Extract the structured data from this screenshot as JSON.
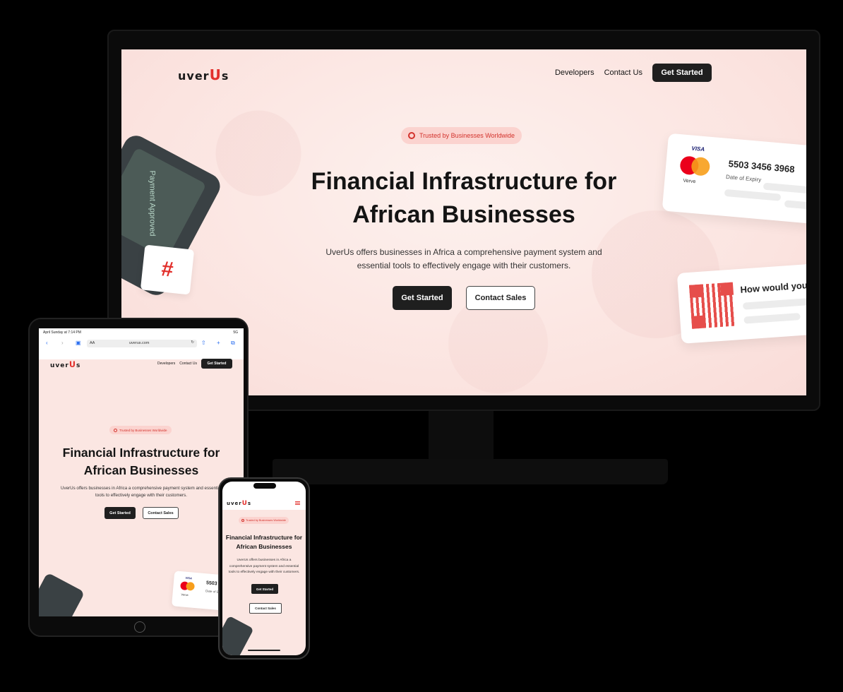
{
  "brand": {
    "logo_prefix": "uver",
    "logo_accent": "U",
    "logo_suffix": "s",
    "accent_color": "#e2302c",
    "dark_color": "#1f1f1f"
  },
  "nav": {
    "developers": "Developers",
    "contact": "Contact Us",
    "get_started": "Get Started"
  },
  "hero": {
    "badge": "Trusted by Businesses Worldwide",
    "title_line1": "Financial Infrastructure for",
    "title_line2": "African Businesses",
    "subtitle": "UverUs offers businesses in Africa a comprehensive payment system and essential tools to effectively engage with their customers.",
    "cta_primary": "Get Started",
    "cta_secondary": "Contact Sales"
  },
  "cards": {
    "pos_text": "Payment Approved",
    "hash_symbol": "#",
    "visa": "VISA",
    "verve": "Verve",
    "card_number": "5503 3456 3968",
    "card_number_short": "5503",
    "expiry_label": "Date of Expiry",
    "expiry_label_short": "Date of Expi",
    "qr_prompt": "How would you"
  },
  "tablet_browser": {
    "status_time": "April Sunday at 7:14 PM",
    "status_right": "5G",
    "aa_label": "AA",
    "url": "uverus.com"
  },
  "icons": [
    "award-icon",
    "menu-icon",
    "back-arrow-icon",
    "forward-arrow-icon",
    "book-icon",
    "refresh-icon",
    "share-icon",
    "plus-icon",
    "tabs-icon",
    "home-button"
  ]
}
